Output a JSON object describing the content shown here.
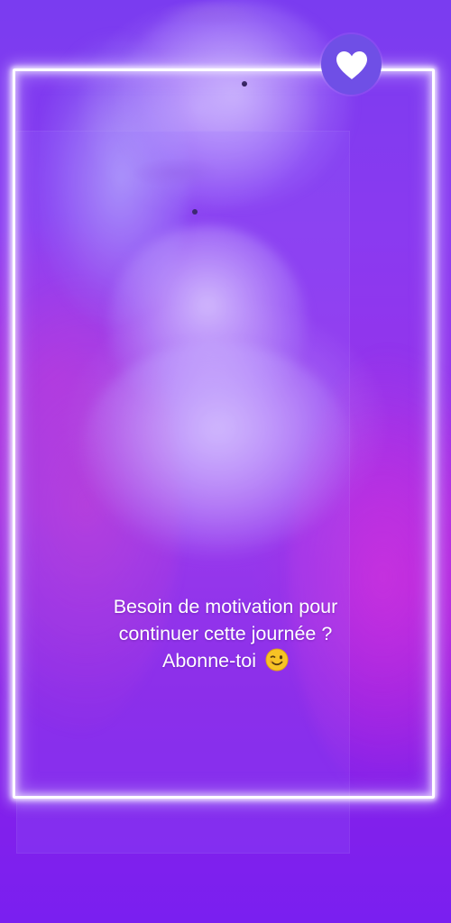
{
  "story": {
    "caption_lines": [
      "Besoin de motivation pour",
      "continuer cette journée ?",
      "Abonne-toi"
    ],
    "caption_emoji": "winking-face-emoji"
  },
  "like_button": {
    "icon": "heart-icon",
    "background": "#6f4fe6",
    "icon_color": "#ffffff"
  },
  "theme": {
    "background": "#7a1ff0",
    "frame_color": "#ffffff"
  }
}
